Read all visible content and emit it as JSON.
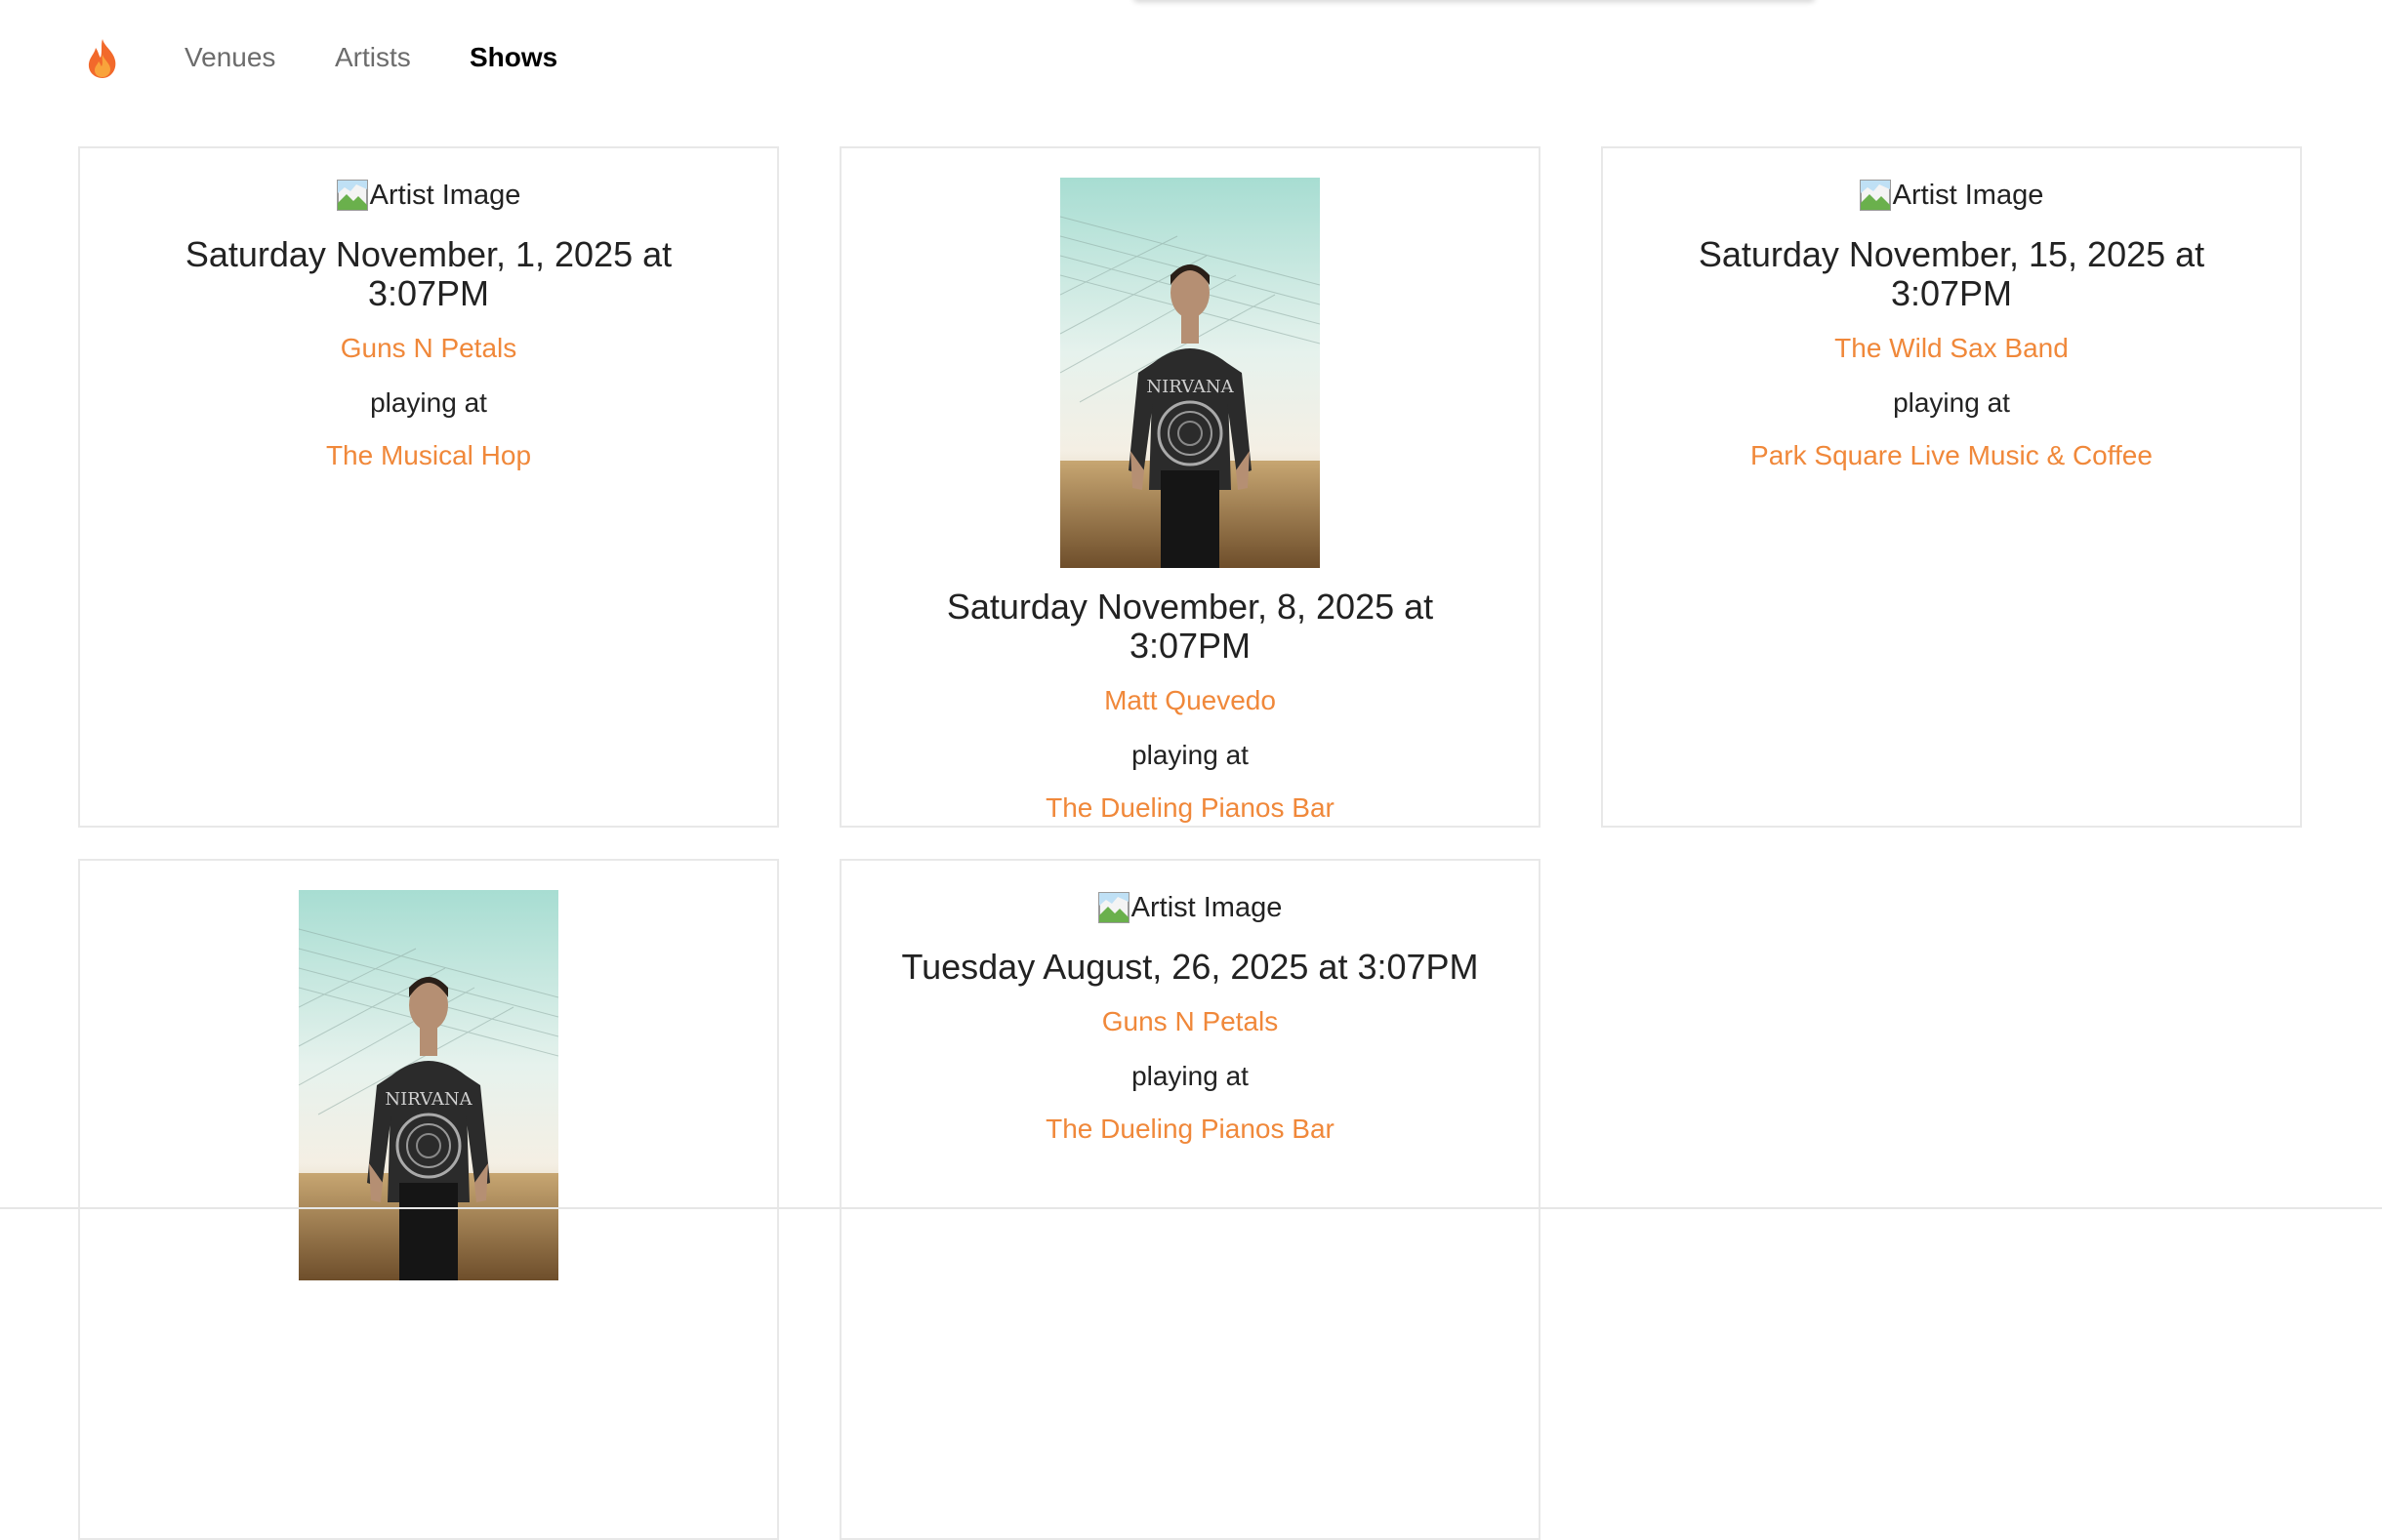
{
  "nav": {
    "logo_icon": "flame-icon",
    "links": [
      {
        "label": "Venues",
        "active": false
      },
      {
        "label": "Artists",
        "active": false
      },
      {
        "label": "Shows",
        "active": true
      }
    ]
  },
  "colors": {
    "accent": "#f0883a",
    "border": "#e8e8e8",
    "nav_inactive": "#6c6c6c"
  },
  "shows": [
    {
      "image_alt": "Artist Image",
      "image_broken": true,
      "date": "Saturday November, 1, 2025 at 3:07PM",
      "artist": "Guns N Petals",
      "playing_at": "playing at",
      "venue": "The Musical Hop"
    },
    {
      "image_alt": "",
      "image_broken": false,
      "date": "Saturday November, 8, 2025 at 3:07PM",
      "artist": "Matt Quevedo",
      "playing_at": "playing at",
      "venue": "The Dueling Pianos Bar"
    },
    {
      "image_alt": "Artist Image",
      "image_broken": true,
      "date": "Saturday November, 15, 2025 at 3:07PM",
      "artist": "The Wild Sax Band",
      "playing_at": "playing at",
      "venue": "Park Square Live Music & Coffee"
    },
    {
      "image_alt": "",
      "image_broken": false,
      "date": "",
      "artist": "",
      "playing_at": "",
      "venue": ""
    },
    {
      "image_alt": "Artist Image",
      "image_broken": true,
      "date": "Tuesday August, 26, 2025 at 3:07PM",
      "artist": "Guns N Petals",
      "playing_at": "playing at",
      "venue": "The Dueling Pianos Bar"
    }
  ]
}
